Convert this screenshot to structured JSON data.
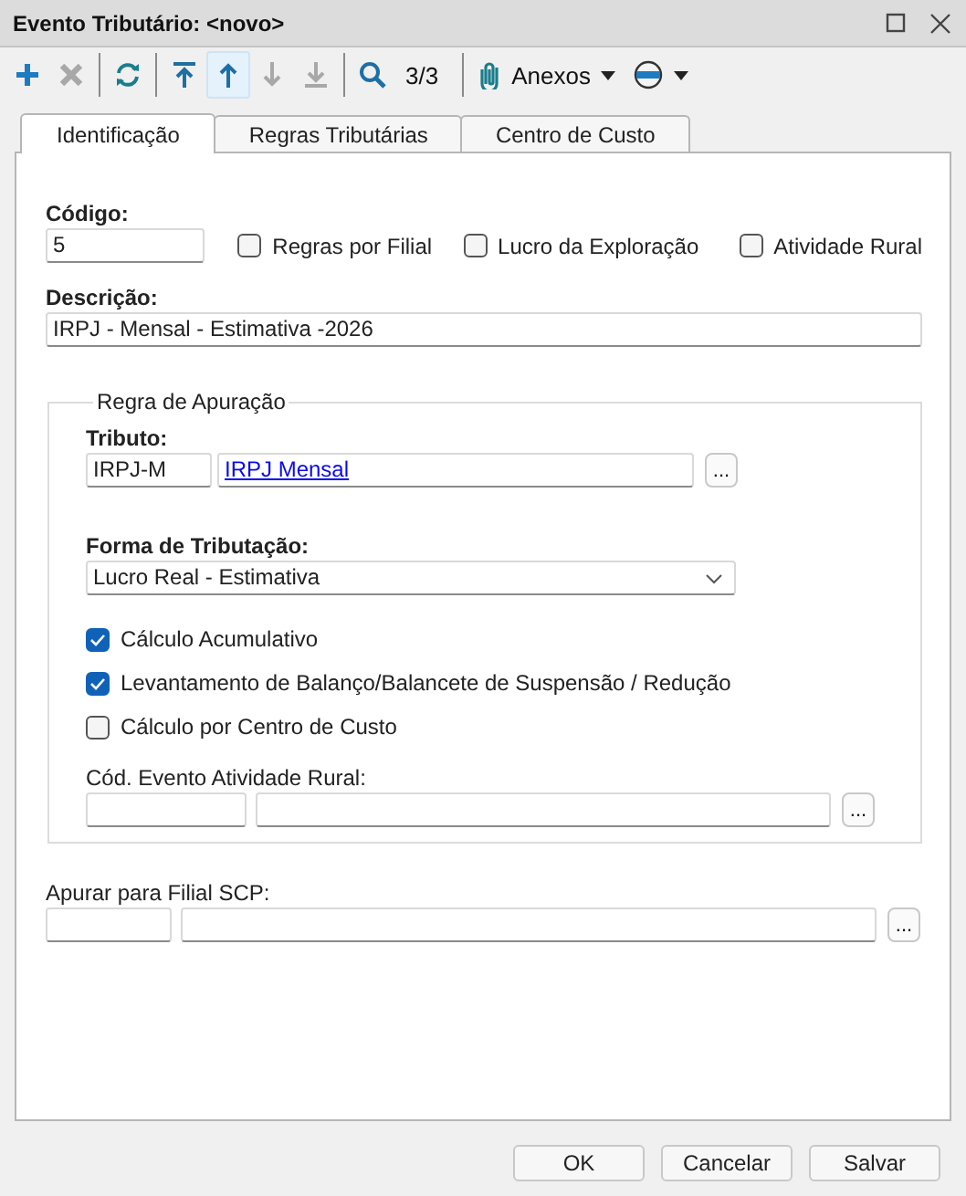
{
  "window": {
    "title": "Evento Tributário: <novo>"
  },
  "toolbar": [
    {
      "kind": "add",
      "disabled": false,
      "highlighted": false
    },
    {
      "kind": "delete",
      "disabled": true,
      "highlighted": false
    },
    {
      "kind": "separator"
    },
    {
      "kind": "refresh",
      "disabled": false,
      "highlighted": false
    },
    {
      "kind": "separator"
    },
    {
      "kind": "first",
      "disabled": false,
      "highlighted": false
    },
    {
      "kind": "prev",
      "disabled": false,
      "highlighted": true
    },
    {
      "kind": "next",
      "disabled": true,
      "highlighted": false
    },
    {
      "kind": "last",
      "disabled": true,
      "highlighted": false
    },
    {
      "kind": "separator"
    },
    {
      "kind": "search",
      "disabled": false,
      "highlighted": false
    },
    {
      "kind": "counter",
      "text": "3/3"
    },
    {
      "kind": "separator"
    },
    {
      "kind": "attachments",
      "label": "Anexos"
    },
    {
      "kind": "disc"
    }
  ],
  "tabs": [
    {
      "label": "Identificação",
      "selected": true
    },
    {
      "label": "Regras Tributárias",
      "selected": false
    },
    {
      "label": "Centro de Custo",
      "selected": false
    }
  ],
  "code": {
    "label": "Código:",
    "value": "5"
  },
  "flags": [
    {
      "label": "Regras por Filial",
      "checked": false
    },
    {
      "label": "Lucro da Exploração",
      "checked": false
    },
    {
      "label": "Atividade Rural",
      "checked": false
    }
  ],
  "description": {
    "label": "Descrição:",
    "value": "IRPJ - Mensal - Estimativa -2026"
  },
  "group": {
    "title": "Regra de Apuração",
    "tributo": {
      "label": "Tributo:",
      "code": "IRPJ-M",
      "name": "IRPJ Mensal",
      "browse": "..."
    },
    "forma": {
      "label": "Forma de Tributação:",
      "value": "Lucro Real - Estimativa"
    },
    "options": [
      {
        "label": "Cálculo Acumulativo",
        "checked": true
      },
      {
        "label": "Levantamento de Balanço/Balancete de Suspensão / Redução",
        "checked": true
      },
      {
        "label": "Cálculo por Centro de Custo",
        "checked": false
      }
    ],
    "rural": {
      "label": "Cód. Evento Atividade Rural:",
      "browse": "..."
    }
  },
  "scp": {
    "label": "Apurar para Filial SCP:",
    "browse": "..."
  },
  "buttons": [
    "OK",
    "Cancelar",
    "Salvar"
  ]
}
